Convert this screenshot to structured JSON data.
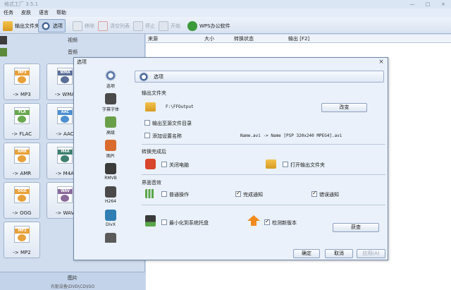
{
  "app": {
    "title": "格式工厂 3.5.1",
    "window_controls": [
      "—",
      "□",
      "×"
    ]
  },
  "menu": [
    "任务",
    "皮肤",
    "语言",
    "帮助"
  ],
  "toolbar": [
    {
      "label": "输出文件夹",
      "icon": "folder-icon",
      "state": "normal"
    },
    {
      "label": "选项",
      "icon": "options-icon",
      "state": "active"
    },
    {
      "label": "移除",
      "icon": "remove-icon",
      "state": "disabled"
    },
    {
      "label": "清空列表",
      "icon": "clear-list-icon",
      "state": "disabled"
    },
    {
      "label": "停止",
      "icon": "stop-icon",
      "state": "disabled"
    },
    {
      "label": "开始",
      "icon": "start-icon",
      "state": "disabled"
    },
    {
      "label": "WPS办公软件",
      "icon": "wps-icon",
      "state": "normal"
    }
  ],
  "left_panel": {
    "categories": [
      "视频",
      "音频"
    ],
    "formats": [
      {
        "label": "-> MP3",
        "tag": "MP3",
        "color": "#e8a13a"
      },
      {
        "label": "-> WMA",
        "tag": "WMA",
        "color": "#5a6f98"
      },
      {
        "label": "-> FLAC",
        "tag": "FLA",
        "color": "#6aa84f"
      },
      {
        "label": "-> AAC",
        "tag": "AAC",
        "color": "#4d8fcf"
      },
      {
        "label": "-> AMR",
        "tag": "AMR",
        "color": "#e8a13a"
      },
      {
        "label": "-> M4A",
        "tag": "M4A",
        "color": "#3e7f6f"
      },
      {
        "label": "-> OGG",
        "tag": "OGG",
        "color": "#e8a13a"
      },
      {
        "label": "-> WAV",
        "tag": "WAV",
        "color": "#8a6a9a"
      },
      {
        "label": "-> MP2",
        "tag": "MP2",
        "color": "#e8a13a"
      }
    ],
    "bottom_category": "图片",
    "bottom_sub": "光驱设备\\DVD\\CD\\ISO"
  },
  "list_header": [
    "来源",
    "大小",
    "转换状态",
    "输出 [F2]"
  ],
  "dialog": {
    "title": "选项",
    "close": "×",
    "nav": [
      {
        "label": "选项",
        "color": "#5c7aa8"
      },
      {
        "label": "字幕字体",
        "color": "#4a4a4a"
      },
      {
        "label": "高级",
        "color": "#6a9f4a"
      },
      {
        "label": "图片",
        "color": "#d96b2e"
      },
      {
        "label": "RMVB",
        "color": "#3b3b3b"
      },
      {
        "label": "H264",
        "color": "#4a4a4a"
      },
      {
        "label": "DivX",
        "color": "#2f7fb5"
      }
    ],
    "nav_scroll": "▼",
    "panel_title": "选项",
    "output_folder": {
      "section": "输出文件夹",
      "path": "F:\\FFOutput",
      "change_button": "改变",
      "use_source_dir": "输出至源文件目录",
      "add_setting_name": "添加设置名称",
      "name_example": "Name.avi  -> Name [PSP 320x240 MPEG4].avi"
    },
    "after_convert": {
      "section": "转换完成后",
      "shutdown": "关闭电脑",
      "open_output": "打开输出文件夹"
    },
    "ui_sound": {
      "section": "界面音效",
      "normal_op": "普通操作",
      "complete_notify": "完成通知",
      "error_notify": "错误通知"
    },
    "misc": {
      "minimize_tray": "最小化到系统托盘",
      "check_update": "检测新版本",
      "check_button": "获查"
    },
    "buttons": {
      "ok": "确定",
      "cancel": "取消",
      "apply": "应用(A)"
    }
  }
}
